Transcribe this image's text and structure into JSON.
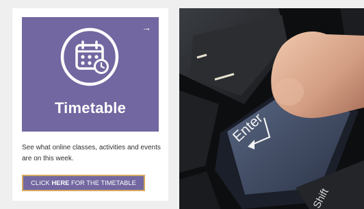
{
  "card": {
    "title": "Timetable",
    "description": "See what online classes, activities and events are on this week.",
    "arrow_icon": "arrow-right-icon",
    "calendar_icon": "calendar-clock-icon",
    "cta": {
      "prefix": "CLICK ",
      "emphasis": "HERE",
      "suffix": " FOR THE TIMETABLE"
    }
  },
  "photo": {
    "enter_key_label": "Enter",
    "shift_key_label": "Shift"
  },
  "colors": {
    "accent_purple": "#7267a0",
    "button_border_gold": "#d5a95e",
    "page_background": "#efefef"
  }
}
